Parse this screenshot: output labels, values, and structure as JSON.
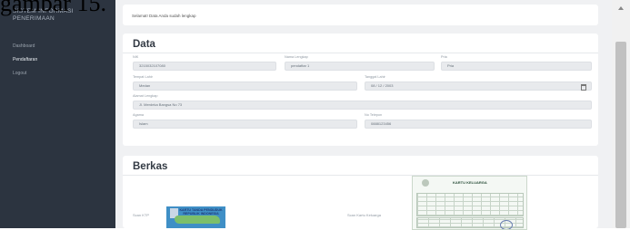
{
  "caption": "gambar 15.",
  "sidebar": {
    "brand": "SISTEM INFORMASI PENERIMAAN",
    "items": [
      {
        "label": "Dashboard",
        "active": false
      },
      {
        "label": "Pendaftaran",
        "active": true
      },
      {
        "label": "Logout",
        "active": false
      }
    ]
  },
  "alert": {
    "text": "Selamat! Data Anda sudah lengkap"
  },
  "data_card": {
    "title": "Data",
    "fields": {
      "nik": {
        "label": "NIK",
        "value": "3215032107080"
      },
      "nama": {
        "label": "Nama Lengkap",
        "value": "pendaftar 1"
      },
      "pria": {
        "label": "Pria",
        "value": "Pria"
      },
      "tempat_lahir": {
        "label": "Tempat Lahir",
        "value": "Medan"
      },
      "tanggal_lahir": {
        "label": "Tanggal Lahir",
        "value": "08 / 12 / 2003"
      },
      "alamat": {
        "label": "Alamat Lengkap",
        "value": "Jl. Merdeka Bangsa No 73"
      },
      "agama": {
        "label": "Agama",
        "value": "Islam"
      },
      "telepon": {
        "label": "No Telepon",
        "value": "0888123456"
      }
    }
  },
  "berkas_card": {
    "title": "Berkas",
    "ktp_label": "Scan KTP",
    "ktp_title": "KARTU TANDA PENDUDUK REPUBLIK INDONESIA",
    "kk_label": "Scan Kartu Keluarga",
    "kk_title": "KARTU KELUARGA"
  },
  "colors": {
    "sidebar": "#2c3440",
    "main_bg": "#f0f1f3",
    "card": "#ffffff",
    "input": "#e8eaed"
  }
}
